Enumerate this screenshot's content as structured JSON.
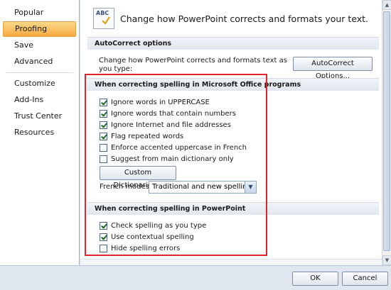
{
  "sidebar": {
    "items": [
      {
        "label": "Popular",
        "active": false
      },
      {
        "label": "Proofing",
        "active": true
      },
      {
        "label": "Save",
        "active": false
      },
      {
        "label": "Advanced",
        "active": false
      },
      {
        "label": "Customize",
        "active": false
      },
      {
        "label": "Add-Ins",
        "active": false
      },
      {
        "label": "Trust Center",
        "active": false
      },
      {
        "label": "Resources",
        "active": false
      }
    ]
  },
  "header": {
    "icon": "abc-spellcheck-icon",
    "text": "Change how PowerPoint corrects and formats your text."
  },
  "autocorrect": {
    "section_title": "AutoCorrect options",
    "description": "Change how PowerPoint corrects and formats text as you type:",
    "button_label": "AutoCorrect Options..."
  },
  "office_spelling": {
    "section_title": "When correcting spelling in Microsoft Office programs",
    "options": [
      {
        "label": "Ignore words in UPPERCASE",
        "checked": true
      },
      {
        "label": "Ignore words that contain numbers",
        "checked": true
      },
      {
        "label": "Ignore Internet and file addresses",
        "checked": true
      },
      {
        "label": "Flag repeated words",
        "checked": true
      },
      {
        "label": "Enforce accented uppercase in French",
        "checked": false
      },
      {
        "label": "Suggest from main dictionary only",
        "checked": false
      }
    ],
    "custom_dictionaries_label": "Custom Dictionaries...",
    "french_modes_label": "French modes:",
    "french_modes_value": "Traditional and new spellings"
  },
  "ppt_spelling": {
    "section_title": "When correcting spelling in PowerPoint",
    "options": [
      {
        "label": "Check spelling as you type",
        "checked": true
      },
      {
        "label": "Use contextual spelling",
        "checked": true
      },
      {
        "label": "Hide spelling errors",
        "checked": false
      }
    ]
  },
  "footer": {
    "ok_label": "OK",
    "cancel_label": "Cancel"
  },
  "colors": {
    "highlight": "#e0262a",
    "active_nav": "#f6a941",
    "accent": "#35507a"
  }
}
